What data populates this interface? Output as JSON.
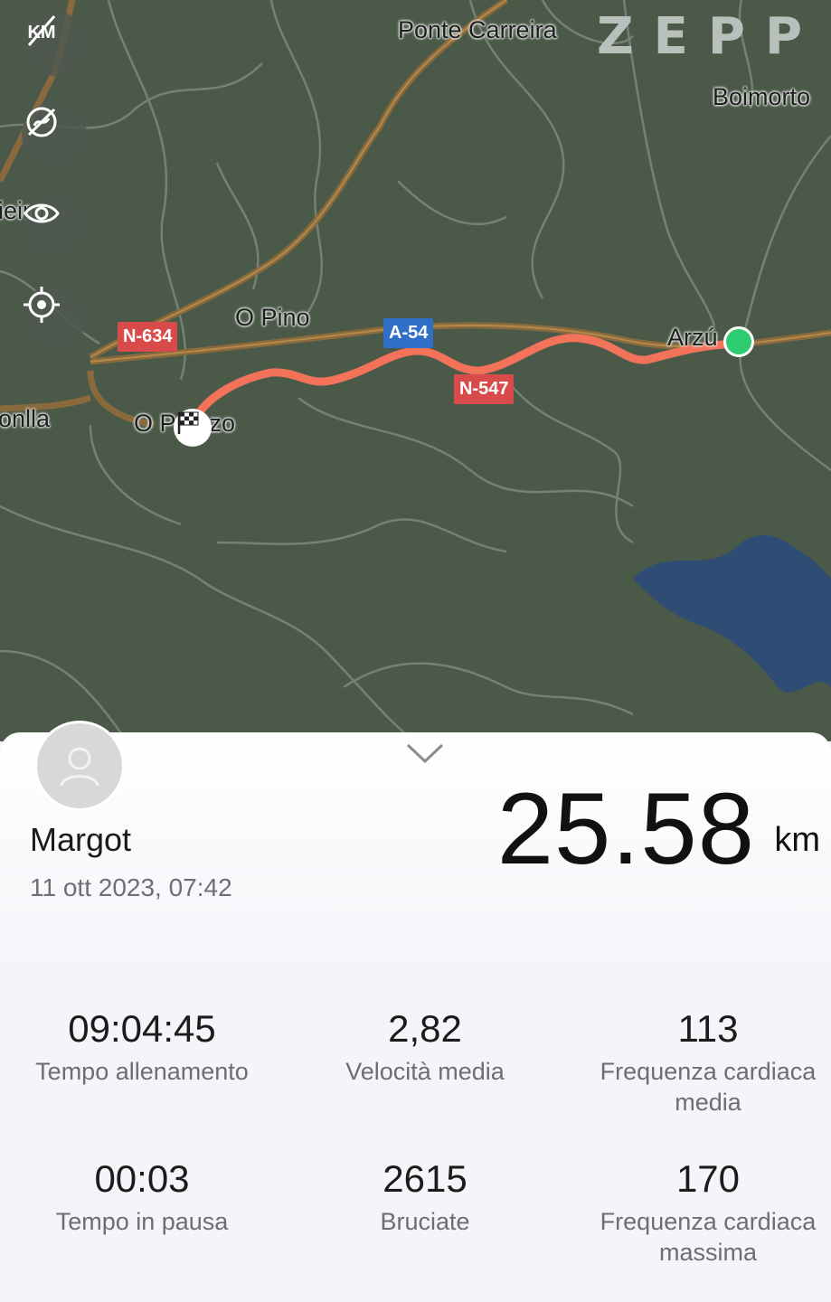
{
  "map": {
    "logo": "ZEPP",
    "places": {
      "ponte_carreira": "Ponte Carreira",
      "boimorto": "Boimorto",
      "o_pino": "O Pino",
      "arzua": "Arzú",
      "o_pedrouzo": "O P  ouzo",
      "left_top": "ieiro",
      "left_bottom": "onlla"
    },
    "roads": {
      "n634": "N-634",
      "a54": "A-54",
      "n547": "N-547"
    },
    "controls": [
      "km-off-icon",
      "route-hide-icon",
      "eye-icon",
      "locate-icon"
    ]
  },
  "workout": {
    "user_name": "Margot",
    "datetime": "11 ott 2023, 07:42",
    "distance": "25.58",
    "distance_unit": "km"
  },
  "stats": [
    {
      "value": "09:04:45",
      "label": "Tempo allenamento"
    },
    {
      "value": "2,82",
      "label": "Velocità media"
    },
    {
      "value": "113",
      "label": "Frequenza cardiaca media"
    },
    {
      "value": "00:03",
      "label": "Tempo in pausa"
    },
    {
      "value": "2615",
      "label": "Bruciate"
    },
    {
      "value": "170",
      "label": "Frequenza cardiaca massima"
    }
  ],
  "colors": {
    "route": "#f2725a",
    "map_bg": "#4b5a48",
    "start_marker": "#2ecc71"
  }
}
